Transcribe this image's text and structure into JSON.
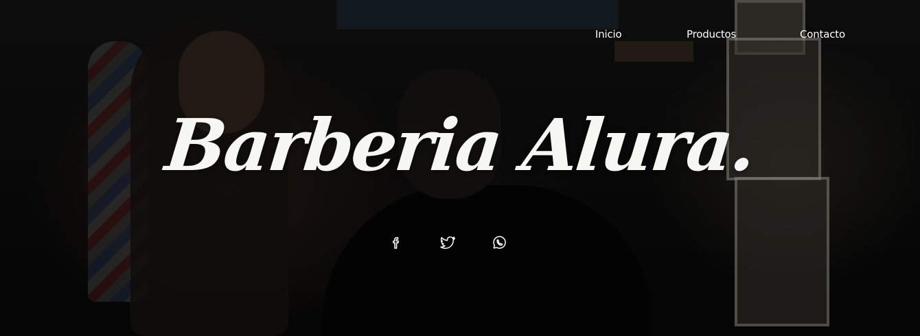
{
  "nav": {
    "items": [
      {
        "label": "Inicio"
      },
      {
        "label": "Productos"
      },
      {
        "label": "Contacto"
      }
    ]
  },
  "hero": {
    "title": "Barberia Alura."
  },
  "social": {
    "icons": [
      "facebook-icon",
      "twitter-icon",
      "whatsapp-icon"
    ]
  },
  "colors": {
    "text": "#ffffff",
    "title": "#f6f7f3",
    "background": "#0b0b0b"
  }
}
